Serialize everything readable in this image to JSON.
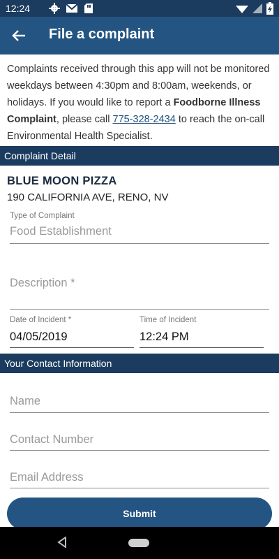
{
  "status": {
    "time": "12:24",
    "left_icons": [
      "settings-icon",
      "mail-icon",
      "sd-card-icon"
    ],
    "right_icons": [
      "wifi-icon",
      "signal-icon",
      "battery-icon"
    ]
  },
  "appbar": {
    "title": "File a complaint",
    "back_icon": "arrow-left-icon"
  },
  "notice": {
    "part1": "Complaints received through this app will not be monitored weekdays between 4:30pm and 8:00am, weekends, or holidays. If you would like to report a ",
    "bold": "Foodborne Illness Complaint",
    "part2": ", please call ",
    "phone": "775-328-2434",
    "part3": " to reach the on-call Environmental Health Specialist."
  },
  "complaint_section": {
    "header": "Complaint Detail"
  },
  "establishment": {
    "name": "BLUE MOON PIZZA",
    "address": "190 CALIFORNIA AVE, RENO, NV"
  },
  "form": {
    "type_label": "Type of Complaint",
    "type_value": "Food Establishment",
    "description_placeholder": "Description *",
    "date_label": "Date of Incident *",
    "date_value": "04/05/2019",
    "time_label": "Time of Incident",
    "time_value": "12:24 PM"
  },
  "contact_section": {
    "header": "Your Contact Information"
  },
  "contact": {
    "name_placeholder": "Name",
    "number_placeholder": "Contact Number",
    "email_placeholder": "Email Address"
  },
  "submit_label": "Submit",
  "colors": {
    "appbar": "#245582",
    "section": "#1b3c5f",
    "link": "#1f4f7f"
  }
}
